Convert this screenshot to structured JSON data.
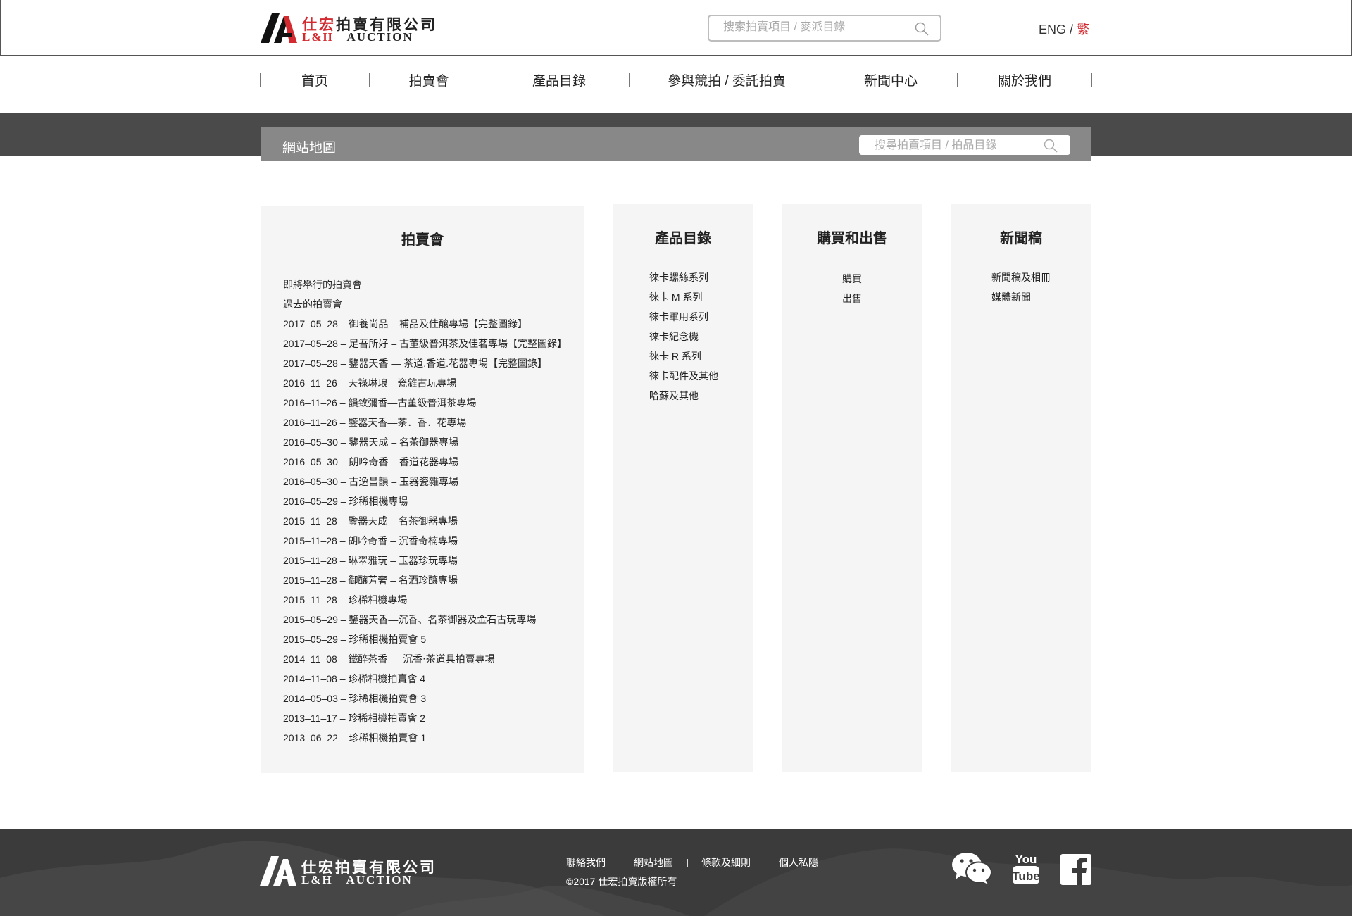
{
  "brand": {
    "name_cn": "仕宏拍賣有限公司",
    "name_en_prefix": "L&H",
    "name_en_suffix": "AUCTION"
  },
  "header": {
    "search_placeholder": "搜索拍賣項目 / 麥派目錄",
    "lang_en": "ENG",
    "lang_sep": "/",
    "lang_tc": "繁"
  },
  "nav": {
    "items": [
      "首页",
      "拍賣會",
      "產品目錄",
      "參與競拍 / 委託拍賣",
      "新聞中心",
      "關於我們"
    ]
  },
  "banner": {
    "title": "網站地圖",
    "search_placeholder": "搜尋拍賣項目 / 拍品目錄"
  },
  "sitemap": {
    "auctions": {
      "heading": "拍賣會",
      "links": [
        "即將舉行的拍賣會",
        "過去的拍賣會",
        "2017–05–28 – 御養尚品 – 補品及佳釀專場【完整圖錄】",
        "2017–05–28 – 足吾所好 – 古董級普洱茶及佳茗專場【完整圖錄】",
        "2017–05–28 – 鑒器天香 — 茶道.香道.花器專場【完整圖錄】",
        "2016–11–26 – 天祿琳琅—瓷雜古玩專場",
        "2016–11–26 – 韻致彌香—古董級普洱茶專場",
        "2016–11–26 – 鑒器天香—茶．香．花專場",
        "2016–05–30 – 鑒器天成 – 名茶御器專場",
        "2016–05–30 – 朗吟奇香 – 香道花器專場",
        "2016–05–30 – 古逸昌韻 – 玉器瓷雜專場",
        "2016–05–29 – 珍稀相機專場",
        "2015–11–28 – 鑒器天成 – 名茶御器專場",
        "2015–11–28 – 朗吟奇香 – 沉香奇楠專場",
        "2015–11–28 – 琳翠雅玩 – 玉器珍玩專場",
        "2015–11–28 – 御釀芳奢 – 名酒珍釀專場",
        "2015–11–28 – 珍稀相機專場",
        "2015–05–29 – 鑒器天香—沉香、名茶御器及金石古玩專場",
        "2015–05–29 – 珍稀相機拍賣會 5",
        "2014–11–08 – 鐵醉茶香 — 沉香‧茶道具拍賣專場",
        "2014–11–08 – 珍稀相機拍賣會 4",
        "2014–05–03 – 珍稀相機拍賣會 3",
        "2013–11–17 – 珍稀相機拍賣會 2",
        "2013–06–22 – 珍稀相機拍賣會 1"
      ]
    },
    "catalog": {
      "heading": "產品目錄",
      "links": [
        "徠卡螺絲系列",
        "徠卡 M 系列",
        "徠卡軍用系列",
        "徠卡紀念機",
        "徠卡 R 系列",
        "徠卡配件及其他",
        "哈蘇及其他"
      ]
    },
    "buy_sell": {
      "heading": "購買和出售",
      "links": [
        "購買",
        "出售"
      ]
    },
    "news": {
      "heading": "新聞稿",
      "links": [
        "新聞稿及相冊",
        "媒體新聞"
      ]
    }
  },
  "footer": {
    "links": [
      "聯絡我們",
      "網站地圖",
      "條款及細則",
      "個人私隱"
    ],
    "copyright": "©2017 仕宏拍賣版權所有",
    "social": [
      "wechat-icon",
      "youtube-icon",
      "facebook-icon"
    ],
    "youtube_text_top": "You",
    "youtube_text_bottom": "Tube"
  },
  "colors": {
    "accent_red": "#d22a2f",
    "banner_band": "#4a4a4a",
    "banner_box": "#888888",
    "column_bg": "#f5f5f5",
    "footer_bg": "#3b3b3b"
  }
}
